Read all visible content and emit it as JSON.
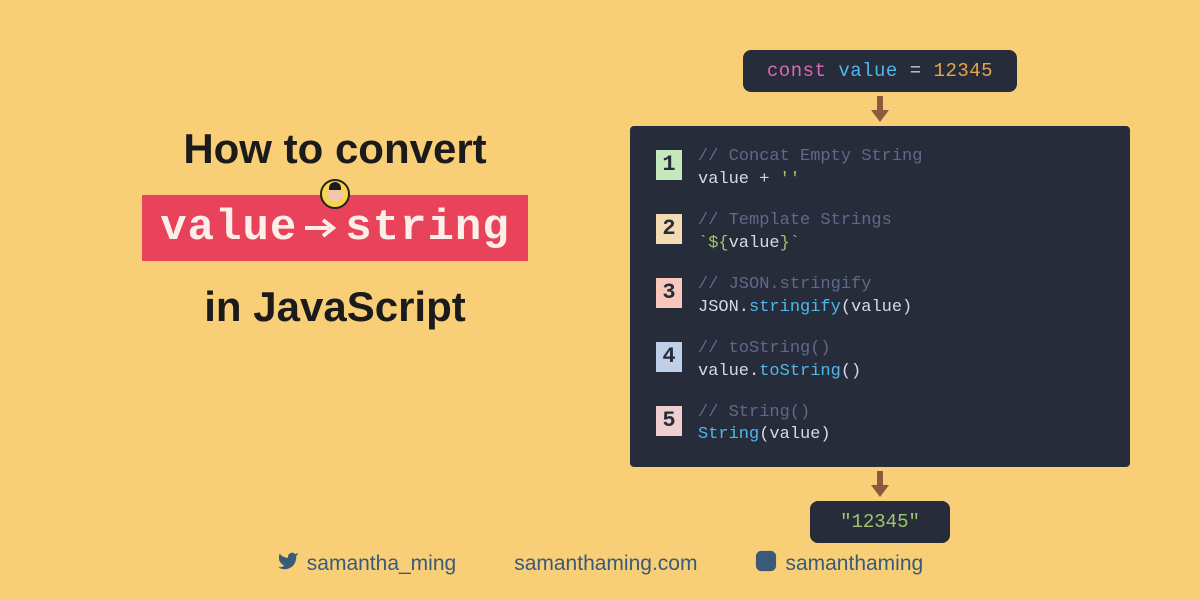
{
  "title": {
    "line1": "How to convert",
    "badge_left": "value",
    "badge_right": "string",
    "line2": "in JavaScript"
  },
  "const_declaration": {
    "keyword": "const",
    "variable": "value",
    "equals": "=",
    "number": "12345"
  },
  "methods": [
    {
      "num": "1",
      "comment": "// Concat Empty String",
      "code": "value + ''"
    },
    {
      "num": "2",
      "comment": "// Template Strings",
      "code": "`${value}`"
    },
    {
      "num": "3",
      "comment": "// JSON.stringify",
      "code_html": "JSON.<span class='fn'>stringify</span>(value)"
    },
    {
      "num": "4",
      "comment": "// toString()",
      "code_html": "value.<span class='fn'>toString</span>()"
    },
    {
      "num": "5",
      "comment": "// String()",
      "code_html": "<span class='fn'>String</span>(value)"
    }
  ],
  "result": "\"12345\"",
  "footer": {
    "twitter": "samantha_ming",
    "website": "samanthaming.com",
    "instagram": "samanthaming"
  }
}
